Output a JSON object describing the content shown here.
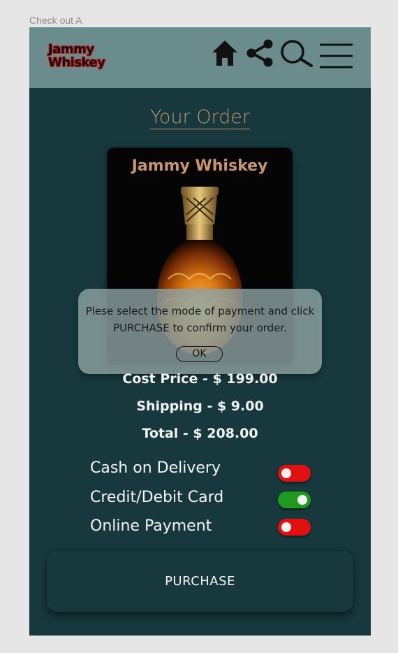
{
  "canvas_label": "Check out A",
  "header": {
    "logo_line1": "Jammy",
    "logo_line2": "Whiskey",
    "icons": [
      "home-icon",
      "share-icon",
      "search-icon",
      "menu-icon"
    ],
    "background": "#6a8c8c"
  },
  "page": {
    "title": "Your Order",
    "background": "#17393d"
  },
  "product": {
    "name": "Jammy Whiskey"
  },
  "modal": {
    "line1": "Plese select the mode of payment and click",
    "line2": "PURCHASE to confirm your order.",
    "ok_label": "OK"
  },
  "pricing": {
    "cost": "Cost Price  - $ 199.00",
    "shipping": "Shipping  - $ 9.00",
    "total": "Total  - $ 208.00"
  },
  "payment_options": [
    {
      "label": "Cash on Delivery",
      "enabled": false
    },
    {
      "label": "Credit/Debit Card",
      "enabled": true
    },
    {
      "label": "Online Payment",
      "enabled": false
    }
  ],
  "colors": {
    "accent": "#c0946a",
    "toggle_off": "#e31010",
    "toggle_on": "#1f9a1f"
  },
  "purchase_label": "PURCHASE"
}
